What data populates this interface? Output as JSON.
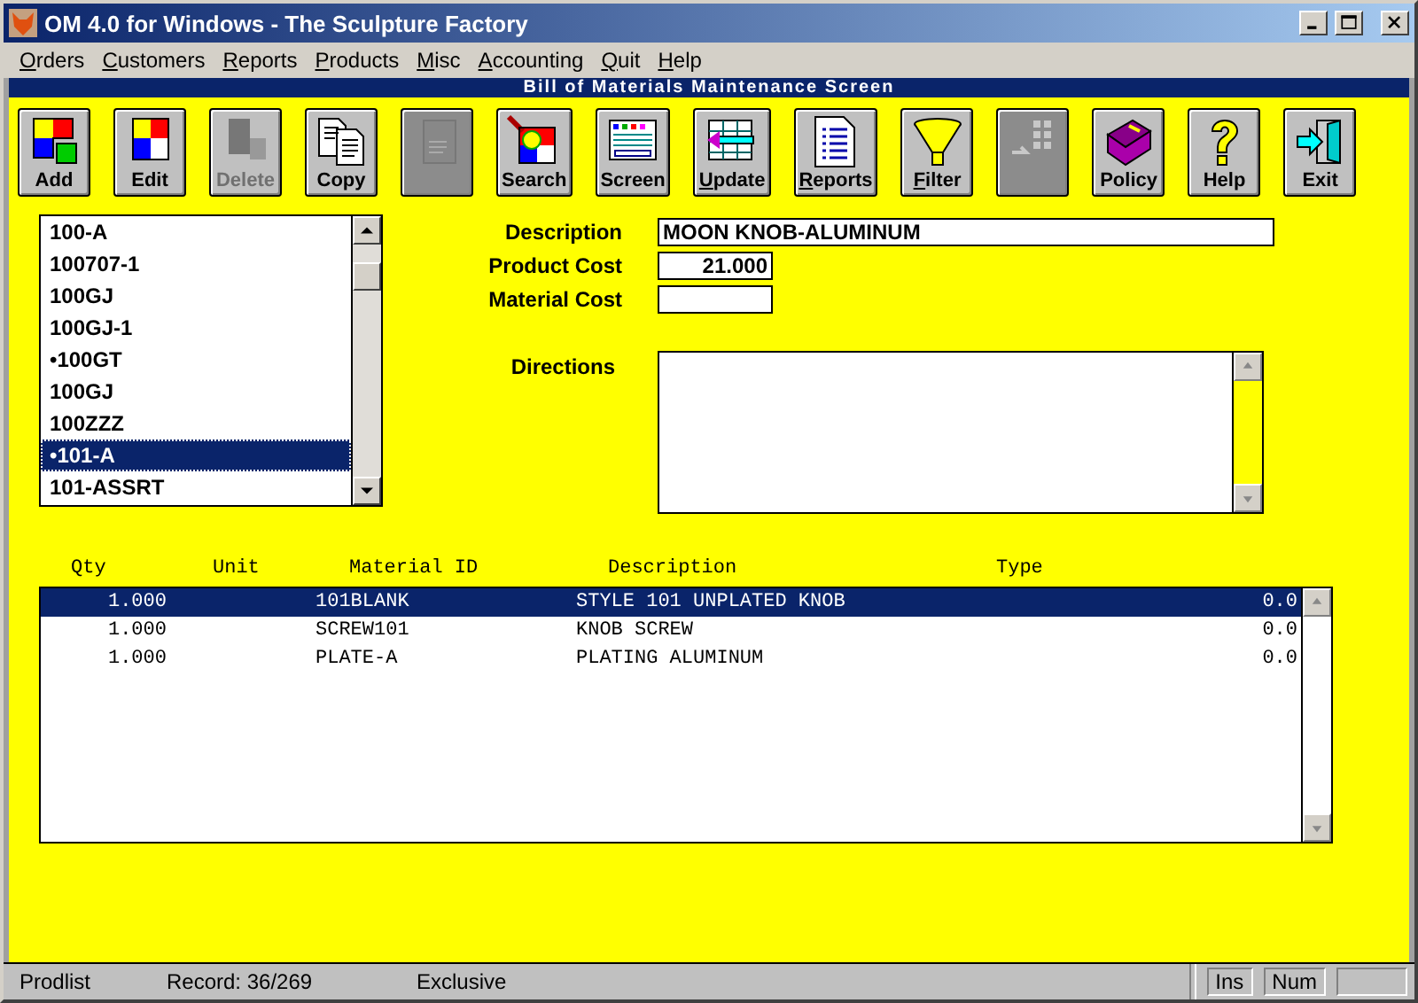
{
  "window": {
    "title": "OM 4.0 for Windows - The Sculpture Factory"
  },
  "menu": [
    "Orders",
    "Customers",
    "Reports",
    "Products",
    "Misc",
    "Accounting",
    "Quit",
    "Help"
  ],
  "screen_title": "Bill of Materials Maintenance Screen",
  "toolbar": [
    {
      "label": "Add",
      "disabled": false,
      "mnemonic": false
    },
    {
      "label": "Edit",
      "disabled": false,
      "mnemonic": false
    },
    {
      "label": "Delete",
      "disabled": true,
      "mnemonic": false
    },
    {
      "label": "Copy",
      "disabled": false,
      "mnemonic": false
    },
    {
      "disabled": true
    },
    {
      "label": "Search",
      "disabled": false,
      "mnemonic": false
    },
    {
      "label": "Screen",
      "disabled": false,
      "mnemonic": false
    },
    {
      "label": "Update",
      "disabled": false,
      "mnemonic": true
    },
    {
      "label": "Reports",
      "disabled": false,
      "mnemonic": true
    },
    {
      "label": "Filter",
      "disabled": false,
      "mnemonic": true
    },
    {
      "disabled": true
    },
    {
      "label": "Policy",
      "disabled": false,
      "mnemonic": false
    },
    {
      "label": "Help",
      "disabled": false,
      "mnemonic": false
    },
    {
      "label": "Exit",
      "disabled": false,
      "mnemonic": false
    }
  ],
  "product_list": {
    "items": [
      {
        "label": "100-A",
        "selected": false
      },
      {
        "label": "100707-1",
        "selected": false
      },
      {
        "label": "100GJ",
        "selected": false
      },
      {
        "label": "100GJ-1",
        "selected": false
      },
      {
        "label": "•100GT",
        "selected": false
      },
      {
        "label": "100GJ",
        "selected": false
      },
      {
        "label": "100ZZZ",
        "selected": false
      },
      {
        "label": "•101-A",
        "selected": true
      },
      {
        "label": "101-ASSRT",
        "selected": false
      }
    ]
  },
  "form": {
    "description_label": "Description",
    "description": "MOON KNOB-ALUMINUM",
    "product_cost_label": "Product Cost",
    "product_cost": "21.000",
    "material_cost_label": "Material Cost",
    "directions_label": "Directions"
  },
  "materials": {
    "columns": [
      "Qty",
      "Unit",
      "Material ID",
      "Description",
      "Type"
    ],
    "rows": [
      {
        "qty": "1.000",
        "material_id": "101BLANK",
        "description": "STYLE 101 UNPLATED KNOB",
        "column_6": "0.0",
        "selected": true
      },
      {
        "qty": "1.000",
        "material_id": "SCREW101",
        "description": "KNOB SCREW",
        "column_6": "0.0",
        "selected": false
      },
      {
        "qty": "1.000",
        "material_id": "PLATE-A",
        "description": "PLATING ALUMINUM",
        "column_6": "0.0",
        "selected": false
      }
    ]
  },
  "status_bar": {
    "panels": [
      "Prodlist",
      "Record: 36/269",
      "Exclusive"
    ],
    "indicators": [
      "Ins",
      "Num"
    ]
  }
}
